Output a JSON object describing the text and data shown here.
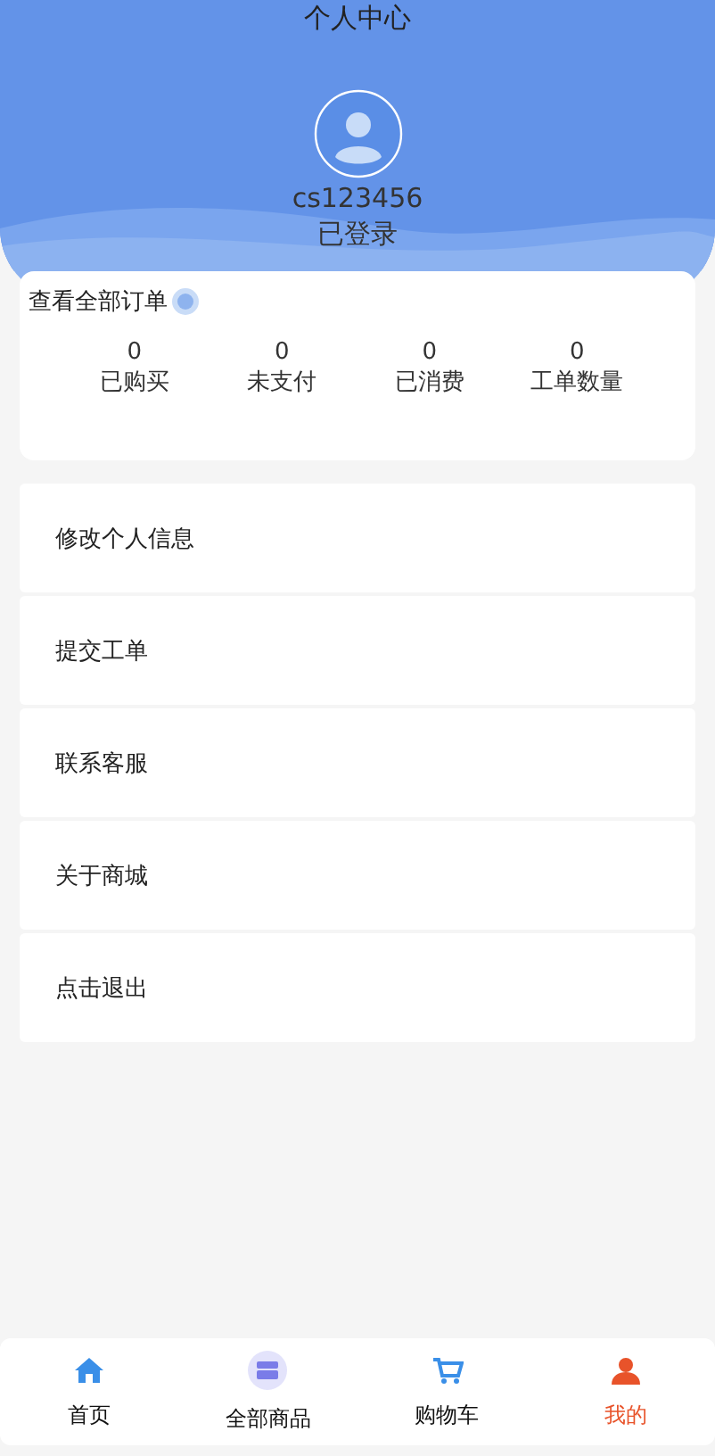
{
  "header": {
    "title": "个人中心",
    "username": "cs123456",
    "status": "已登录"
  },
  "orders": {
    "link": "查看全部订单",
    "stats": [
      {
        "value": "0",
        "label": "已购买"
      },
      {
        "value": "0",
        "label": "未支付"
      },
      {
        "value": "0",
        "label": "已消费"
      },
      {
        "value": "0",
        "label": "工单数量"
      }
    ]
  },
  "menu": [
    "修改个人信息",
    "提交工单",
    "联系客服",
    "关于商城",
    "点击退出"
  ],
  "tabbar": [
    {
      "label": "首页",
      "kind": "home",
      "selected": false
    },
    {
      "label": "全部商品",
      "kind": "shop",
      "selected": false
    },
    {
      "label": "购物车",
      "kind": "cart",
      "selected": false
    },
    {
      "label": "我的",
      "kind": "user",
      "selected": true
    }
  ]
}
